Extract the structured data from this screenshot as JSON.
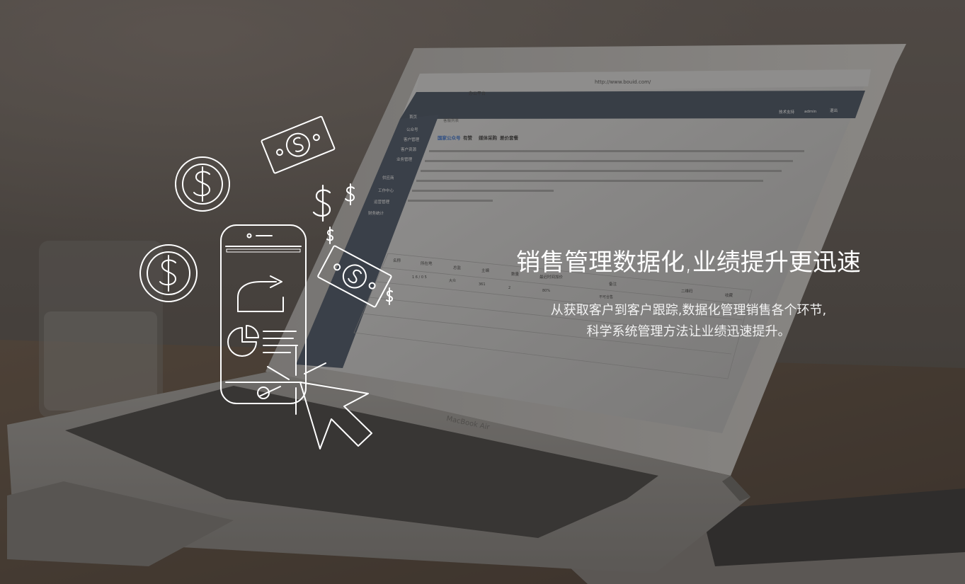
{
  "hero": {
    "headline": "销售管理数据化,业绩提升更迅速",
    "sub_line1": "从获取客户到客户跟踪,数据化管理销售各个环节,",
    "sub_line2": "科学系统管理方法让业绩迅速提升。"
  },
  "laptop": {
    "brand": "MacBook Air",
    "url": "http://www.bouid.com/",
    "tab_title": "办公平台",
    "header_links": [
      "技术支持",
      "admin",
      "退出"
    ],
    "breadcrumb": "客服列表",
    "tabs": [
      "国家公众号",
      "有赞",
      "媒体采购",
      "差价套餐"
    ],
    "table_headers": [
      "名称",
      "所在地",
      "总监",
      "主编",
      "数量",
      "最迟时间加价",
      "备注",
      "二维码",
      "收藏"
    ],
    "table_row": [
      "",
      "1 6 / 0 5",
      "大众",
      "361",
      "2",
      "80%",
      "不可合售",
      "",
      ""
    ],
    "sidebar": [
      "首页",
      "公众号",
      "客户管理",
      "客户资源",
      "业务管理",
      "供应商",
      "工作中心",
      "运营管理",
      "财务统计"
    ]
  },
  "colors": {
    "overlay": "#373432",
    "text": "#ffffff",
    "icon_stroke": "#ffffff"
  },
  "icons": [
    "coin-dollar-icon",
    "banknote-icon",
    "dollar-sign-icon",
    "smartphone-icon",
    "cursor-arrow-icon",
    "pie-chart-icon",
    "share-arrow-icon"
  ]
}
